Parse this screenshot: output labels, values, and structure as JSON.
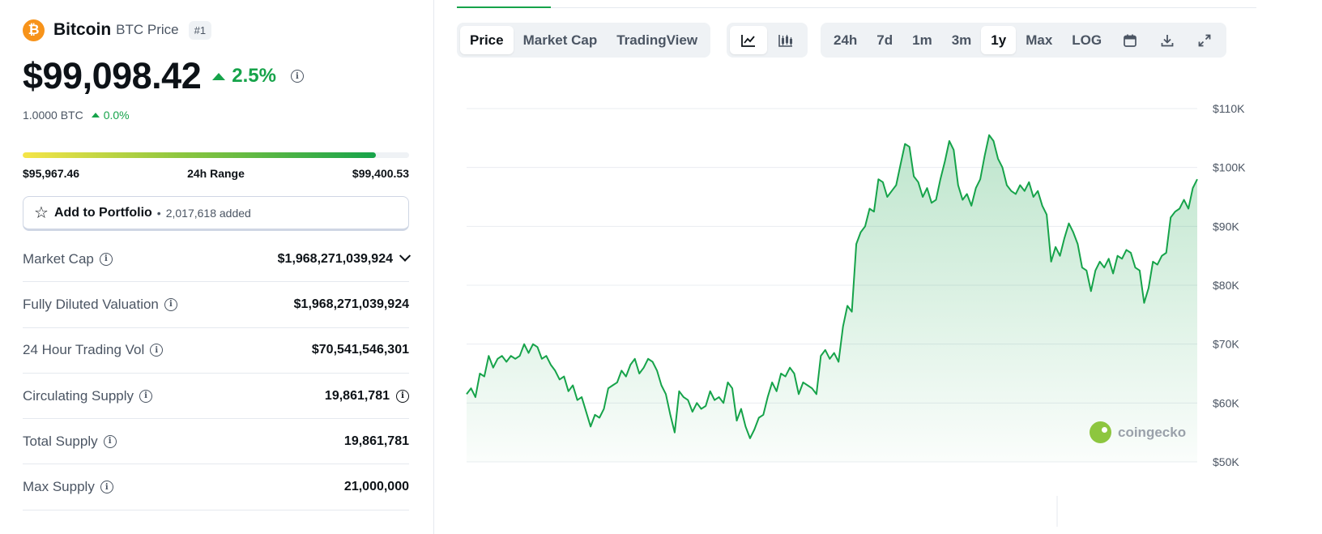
{
  "coin": {
    "name": "Bitcoin",
    "symbol_label": "BTC Price",
    "rank": "#1",
    "logo_glyph": "₿",
    "logo_color": "#f7931a"
  },
  "price": {
    "value": "$99,098.42",
    "change": "2.5%",
    "btc_value": "1.0000 BTC",
    "btc_change": "0.0%",
    "change_color": "#16a34a"
  },
  "range": {
    "low": "$95,967.46",
    "label": "24h Range",
    "high": "$99,400.53",
    "fill_fraction": 0.915
  },
  "portfolio": {
    "label": "Add to Portfolio",
    "added": "2,017,618 added"
  },
  "stats": [
    {
      "label": "Market Cap",
      "value": "$1,968,271,039,924"
    },
    {
      "label": "Fully Diluted Valuation",
      "value": "$1,968,271,039,924"
    },
    {
      "label": "24 Hour Trading Vol",
      "value": "$70,541,546,301"
    },
    {
      "label": "Circulating Supply",
      "value": "19,861,781"
    },
    {
      "label": "Total Supply",
      "value": "19,861,781"
    },
    {
      "label": "Max Supply",
      "value": "21,000,000"
    }
  ],
  "chart_tabs": {
    "types": [
      "Price",
      "Market Cap",
      "TradingView"
    ],
    "active_type": "Price",
    "views": [
      "line-chart-icon",
      "candlestick-icon"
    ],
    "ranges": [
      "24h",
      "7d",
      "1m",
      "3m",
      "1y",
      "Max",
      "LOG"
    ],
    "active_range": "1y",
    "tools": [
      "calendar-icon",
      "download-icon",
      "expand-icon"
    ]
  },
  "watermark": "coingecko",
  "chart_data": {
    "type": "area",
    "range": "1y",
    "ylim": [
      50000,
      110000
    ],
    "y_ticks": [
      {
        "value": 110000,
        "label": "$110K"
      },
      {
        "value": 100000,
        "label": "$100K"
      },
      {
        "value": 90000,
        "label": "$90K"
      },
      {
        "value": 80000,
        "label": "$80K"
      },
      {
        "value": 70000,
        "label": "$70K"
      },
      {
        "value": 60000,
        "label": "$60K"
      },
      {
        "value": 50000,
        "label": "$50K"
      }
    ],
    "grid": true,
    "line_color": "#16a34a",
    "series": [
      {
        "values": [
          61500,
          62500,
          61000,
          65000,
          64500,
          68000,
          66000,
          67500,
          68000,
          67000,
          68000,
          67500,
          68000,
          70000,
          68500,
          70000,
          69500,
          67500,
          68000,
          66500,
          65500,
          64000,
          64500,
          62000,
          63000,
          60500,
          61000,
          58500,
          56000,
          58000,
          57500,
          59000,
          62500,
          63000,
          63500,
          65500,
          64500,
          66500,
          67500,
          65000,
          66000,
          67500,
          67000,
          65500,
          63000,
          61500,
          58000,
          55000,
          62000,
          61000,
          60500,
          58500,
          60000,
          59000,
          59500,
          62000,
          60500,
          61000,
          60000,
          63500,
          62500,
          57000,
          59000,
          56000,
          54000,
          55500,
          57500,
          58000,
          61000,
          63500,
          62000,
          65000,
          64500,
          66000,
          65000,
          61500,
          63500,
          63000,
          62500,
          61500,
          68000,
          69000,
          67500,
          68500,
          67000,
          73000,
          76500,
          75500,
          87000,
          89000,
          90000,
          93000,
          92500,
          98000,
          97500,
          95000,
          96000,
          97000,
          100500,
          104000,
          103500,
          98500,
          97500,
          95000,
          96500,
          94000,
          94500,
          98000,
          101000,
          104500,
          103000,
          97000,
          94500,
          95500,
          93500,
          96500,
          98000,
          102000,
          105500,
          104500,
          101500,
          100000,
          97000,
          96000,
          95500,
          97000,
          96000,
          97500,
          95000,
          96000,
          93500,
          92000,
          84000,
          86500,
          85000,
          88000,
          90500,
          89000,
          87000,
          83000,
          82500,
          79000,
          82500,
          84000,
          83000,
          84500,
          82000,
          85000,
          84500,
          86000,
          85500,
          83000,
          82500,
          77000,
          79500,
          84000,
          83500,
          85000,
          85500,
          91500,
          92500,
          93000,
          94500,
          93000,
          96500,
          98000
        ]
      }
    ]
  }
}
